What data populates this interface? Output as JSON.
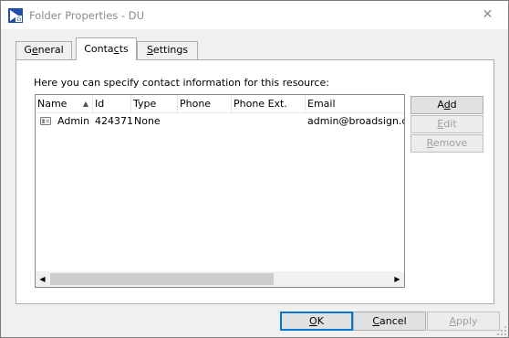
{
  "window": {
    "title": "Folder Properties - DU",
    "close_glyph": "✕"
  },
  "tabs": [
    {
      "label_pre": "G",
      "label_ul": "e",
      "label_post": "neral"
    },
    {
      "label_pre": "Conta",
      "label_ul": "c",
      "label_post": "ts"
    },
    {
      "label_pre": "",
      "label_ul": "S",
      "label_post": "ettings"
    }
  ],
  "contacts_panel": {
    "instructions": "Here you can specify contact information for this resource:",
    "columns": [
      "Name",
      "Id",
      "Type",
      "Phone",
      "Phone Ext.",
      "Email"
    ],
    "sort_glyph": "▲",
    "rows": [
      {
        "name": "Admin",
        "id": "424371",
        "type": "None",
        "phone": "",
        "phone_ext": "",
        "email": "admin@broadsign.com"
      }
    ],
    "scroll_left_glyph": "◀",
    "scroll_right_glyph": "▶"
  },
  "side_buttons": {
    "add": {
      "pre": "A",
      "ul": "d",
      "post": "d"
    },
    "edit": {
      "pre": "",
      "ul": "E",
      "post": "dit"
    },
    "remove": {
      "pre": "",
      "ul": "R",
      "post": "emove"
    }
  },
  "dialog_buttons": {
    "ok": {
      "pre": "",
      "ul": "O",
      "post": "K"
    },
    "cancel": {
      "pre": "",
      "ul": "C",
      "post": "ancel"
    },
    "apply": {
      "pre": "",
      "ul": "A",
      "post": "pply"
    }
  },
  "icons": {
    "app": "broadsign-app-icon",
    "row": "contact-card-icon"
  }
}
